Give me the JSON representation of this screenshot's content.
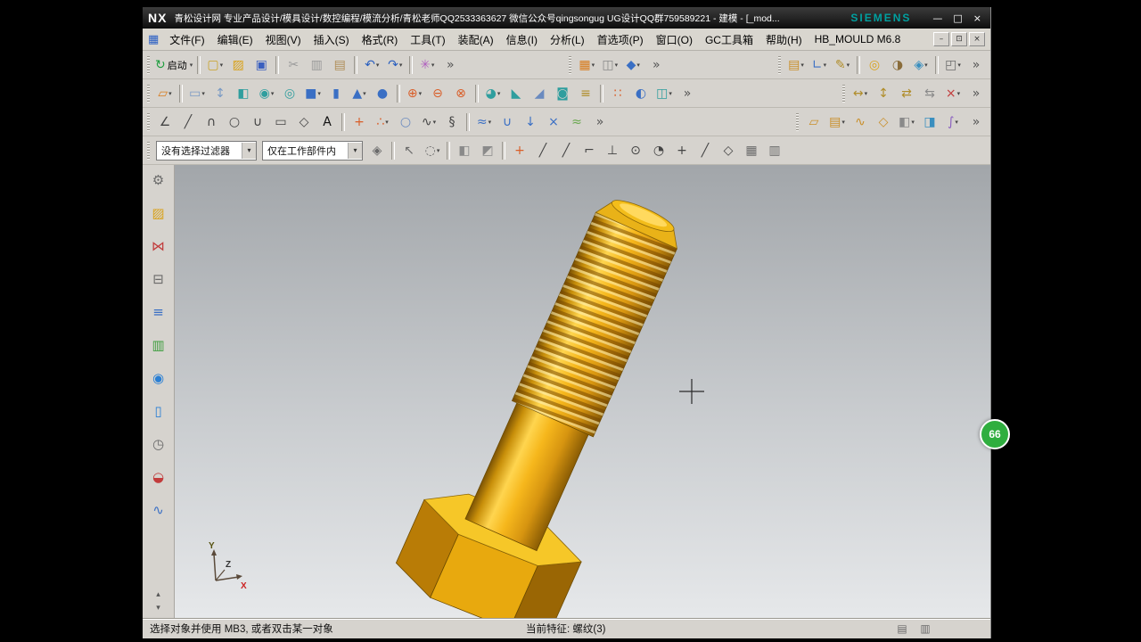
{
  "colors": {
    "brand": "#009999",
    "model_gold": "#f2b41a",
    "badge_green": "#2fae3f",
    "viewport_top": "#a2a6aa",
    "viewport_bottom": "#e6e8ea"
  },
  "window": {
    "logo": "NX",
    "title": "青松设计网 专业产品设计/模具设计/数控编程/模流分析/青松老师QQ2533363627 微信公众号qingsongug UG设计QQ群759589221 - 建模 - [_mod...",
    "brand": "SIEMENS",
    "controls": [
      {
        "n": "minimize-button",
        "g": "—",
        "c": "#ffffff"
      },
      {
        "n": "maximize-button",
        "g": "□",
        "c": "#ffffff"
      },
      {
        "n": "close-button",
        "g": "×",
        "c": "#ffffff"
      }
    ]
  },
  "menubar": {
    "child_icon_glyph": "▦",
    "items": [
      "文件(F)",
      "编辑(E)",
      "视图(V)",
      "插入(S)",
      "格式(R)",
      "工具(T)",
      "装配(A)",
      "信息(I)",
      "分析(L)",
      "首选项(P)",
      "窗口(O)",
      "GC工具箱",
      "帮助(H)",
      "HB_MOULD M6.8"
    ],
    "controls": [
      {
        "n": "child-minimize-button",
        "g": "–",
        "c": "#333333"
      },
      {
        "n": "child-restore-button",
        "g": "⊡",
        "c": "#333333"
      },
      {
        "n": "child-close-button",
        "g": "×",
        "c": "#333333"
      }
    ]
  },
  "toolbars": {
    "standard": [
      {
        "n": "start-button",
        "g": "↻",
        "c": "#1f9e3f",
        "label": "启动",
        "dd": true
      },
      {
        "n": "separator"
      },
      {
        "n": "new-file-button",
        "g": "▢",
        "c": "#c9a227",
        "dd": true
      },
      {
        "n": "open-file-button",
        "g": "▨",
        "c": "#d9a21b"
      },
      {
        "n": "save-button",
        "g": "▣",
        "c": "#3a5fbf"
      },
      {
        "n": "separator"
      },
      {
        "n": "cut-button",
        "g": "✂",
        "c": "#9a9a9a"
      },
      {
        "n": "copy-button",
        "g": "▥",
        "c": "#9a9a9a"
      },
      {
        "n": "paste-button",
        "g": "▤",
        "c": "#b08d57"
      },
      {
        "n": "separator"
      },
      {
        "n": "undo-button",
        "g": "↶",
        "c": "#2a5fbf",
        "dd": true
      },
      {
        "n": "redo-button",
        "g": "↷",
        "c": "#2a5fbf",
        "dd": true
      },
      {
        "n": "separator"
      },
      {
        "n": "command-finder-button",
        "g": "✳",
        "c": "#b05fbf",
        "dd": true
      },
      {
        "n": "overflow-chevron",
        "g": "»",
        "c": "#555555"
      }
    ],
    "view_group": [
      {
        "n": "display-mode-button",
        "g": "▦",
        "c": "#d97b1b",
        "dd": true
      },
      {
        "n": "show-hide-button",
        "g": "◫",
        "c": "#8a8a8a",
        "dd": true
      },
      {
        "n": "render-style-button",
        "g": "◆",
        "c": "#3a6fc4",
        "dd": true
      },
      {
        "n": "overflow-chevron",
        "g": "»",
        "c": "#555555"
      }
    ],
    "utility_group": [
      {
        "n": "layer-settings-button",
        "g": "▤",
        "c": "#c98f2a",
        "dd": true
      },
      {
        "n": "view-orientation-button",
        "g": "∟",
        "c": "#3a6fc4",
        "dd": true
      },
      {
        "n": "wcs-dynamics-button",
        "g": "✎",
        "c": "#b08d2a",
        "dd": true
      },
      {
        "n": "separator"
      },
      {
        "n": "measure-distance-button",
        "g": "◎",
        "c": "#d9a21b"
      },
      {
        "n": "assign-material-button",
        "g": "◑",
        "c": "#8a6d3b"
      },
      {
        "n": "spotlight-button",
        "g": "◈",
        "c": "#3a8fbf",
        "dd": true
      },
      {
        "n": "separator"
      },
      {
        "n": "window-layout-button",
        "g": "◰",
        "c": "#6a6a6a",
        "dd": true
      },
      {
        "n": "overflow-chevron",
        "g": "»",
        "c": "#555555"
      }
    ],
    "feature": [
      {
        "n": "sketch-button",
        "g": "▱",
        "c": "#d97b1b",
        "dd": true
      },
      {
        "n": "separator"
      },
      {
        "n": "datum-plane-button",
        "g": "▭",
        "c": "#7a9ac4",
        "dd": true
      },
      {
        "n": "datum-axis-button",
        "g": "↕",
        "c": "#7a9ac4"
      },
      {
        "n": "extrude-button",
        "g": "◧",
        "c": "#2f9e9e"
      },
      {
        "n": "revolve-button",
        "g": "◉",
        "c": "#2f9e9e",
        "dd": true
      },
      {
        "n": "hole-button",
        "g": "◎",
        "c": "#2f9e9e"
      },
      {
        "n": "block-button",
        "g": "■",
        "c": "#3a6fc4",
        "dd": true
      },
      {
        "n": "cylinder-button",
        "g": "▮",
        "c": "#3a6fc4"
      },
      {
        "n": "cone-button",
        "g": "▲",
        "c": "#3a6fc4",
        "dd": true
      },
      {
        "n": "sphere-button",
        "g": "●",
        "c": "#3a6fc4"
      },
      {
        "n": "separator"
      },
      {
        "n": "unite-button",
        "g": "⊕",
        "c": "#d95f2a",
        "dd": true
      },
      {
        "n": "subtract-button",
        "g": "⊖",
        "c": "#d95f2a"
      },
      {
        "n": "intersect-button",
        "g": "⊗",
        "c": "#d95f2a"
      },
      {
        "n": "separator"
      },
      {
        "n": "edge-blend-button",
        "g": "◕",
        "c": "#2f9e9e",
        "dd": true
      },
      {
        "n": "chamfer-button",
        "g": "◣",
        "c": "#2f9e9e"
      },
      {
        "n": "draft-button",
        "g": "◢",
        "c": "#6a8abf"
      },
      {
        "n": "shell-button",
        "g": "◙",
        "c": "#2f9e9e"
      },
      {
        "n": "thread-button",
        "g": "≡",
        "c": "#b08d2a"
      },
      {
        "n": "separator"
      },
      {
        "n": "pattern-feature-button",
        "g": "∷",
        "c": "#d95f2a"
      },
      {
        "n": "mirror-feature-button",
        "g": "◐",
        "c": "#3a6fc4"
      },
      {
        "n": "trim-body-button",
        "g": "◫",
        "c": "#2f9e9e",
        "dd": true
      },
      {
        "n": "overflow-chevron",
        "g": "»",
        "c": "#555555"
      }
    ],
    "synchronous": [
      {
        "n": "move-face-button",
        "g": "↔",
        "c": "#b08d2a",
        "dd": true
      },
      {
        "n": "pull-face-button",
        "g": "↕",
        "c": "#b08d2a"
      },
      {
        "n": "offset-region-button",
        "g": "⇄",
        "c": "#b08d2a"
      },
      {
        "n": "replace-face-button",
        "g": "⇆",
        "c": "#8a8a8a"
      },
      {
        "n": "delete-face-button",
        "g": "×",
        "c": "#c23b3b",
        "dd": true
      },
      {
        "n": "overflow-chevron",
        "g": "»",
        "c": "#555555"
      }
    ],
    "curve": [
      {
        "n": "profile-button",
        "g": "∠",
        "c": "#444444"
      },
      {
        "n": "line-button",
        "g": "╱",
        "c": "#444444"
      },
      {
        "n": "arc-button",
        "g": "∩",
        "c": "#444444"
      },
      {
        "n": "circle-button",
        "g": "○",
        "c": "#444444"
      },
      {
        "n": "fillet-button",
        "g": "∪",
        "c": "#444444"
      },
      {
        "n": "rectangle-button",
        "g": "▭",
        "c": "#444444"
      },
      {
        "n": "polygon-button",
        "g": "◇",
        "c": "#444444"
      },
      {
        "n": "text-button",
        "g": "A",
        "c": "#111111"
      },
      {
        "n": "separator"
      },
      {
        "n": "point-button",
        "g": "+",
        "c": "#d95f2a"
      },
      {
        "n": "point-set-button",
        "g": "∴",
        "c": "#d95f2a",
        "dd": true
      },
      {
        "n": "ellipse-button",
        "g": "○",
        "c": "#6a8abf"
      },
      {
        "n": "studio-spline-button",
        "g": "∿",
        "c": "#444444",
        "dd": true
      },
      {
        "n": "helix-button",
        "g": "§",
        "c": "#444444"
      },
      {
        "n": "separator"
      },
      {
        "n": "offset-curve-button",
        "g": "≈",
        "c": "#3a6fc4",
        "dd": true
      },
      {
        "n": "bridge-curve-button",
        "g": "∪",
        "c": "#3a6fc4"
      },
      {
        "n": "project-curve-button",
        "g": "↓",
        "c": "#3a6fc4"
      },
      {
        "n": "intersection-curve-button",
        "g": "×",
        "c": "#3a6fc4"
      },
      {
        "n": "section-curve-button",
        "g": "≈",
        "c": "#6aa84f"
      },
      {
        "n": "overflow-chevron",
        "g": "»",
        "c": "#555555"
      }
    ],
    "surface": [
      {
        "n": "ruled-surface-button",
        "g": "▱",
        "c": "#c98f2a"
      },
      {
        "n": "through-curves-button",
        "g": "▤",
        "c": "#c98f2a",
        "dd": true
      },
      {
        "n": "swept-button",
        "g": "∿",
        "c": "#c98f2a"
      },
      {
        "n": "n-sided-surface-button",
        "g": "◇",
        "c": "#c98f2a"
      },
      {
        "n": "offset-surface-button",
        "g": "◧",
        "c": "#8a8a8a",
        "dd": true
      },
      {
        "n": "trimmed-sheet-button",
        "g": "◨",
        "c": "#3a8fbf"
      },
      {
        "n": "sew-button",
        "g": "∫",
        "c": "#8a5fc0",
        "dd": true
      },
      {
        "n": "overflow-chevron",
        "g": "»",
        "c": "#555555"
      }
    ]
  },
  "selection_bar": {
    "filter_label": "没有选择过滤器",
    "scope_label": "仅在工作部件内",
    "icons": [
      {
        "n": "general-selection-filter-button",
        "g": "◈",
        "c": "#6a6a6a"
      },
      {
        "n": "separator"
      },
      {
        "n": "select-cursor-button",
        "g": "↖",
        "c": "#6a6a6a"
      },
      {
        "n": "lasso-button",
        "g": "◌",
        "c": "#6a6a6a",
        "dd": true
      },
      {
        "n": "separator"
      },
      {
        "n": "shaded-solid-button",
        "g": "◧",
        "c": "#8a8a8a"
      },
      {
        "n": "facet-body-button",
        "g": "◩",
        "c": "#8a8a8a"
      },
      {
        "n": "separator"
      },
      {
        "n": "snap-point-toggle",
        "g": "+",
        "c": "#d95f2a"
      },
      {
        "n": "end-point-snap-button",
        "g": "╱",
        "c": "#444444"
      },
      {
        "n": "mid-point-snap-button",
        "g": "╱",
        "c": "#444444"
      },
      {
        "n": "control-point-snap-button",
        "g": "⌐",
        "c": "#444444"
      },
      {
        "n": "intersection-snap-button",
        "g": "⊥",
        "c": "#444444"
      },
      {
        "n": "arc-center-snap-button",
        "g": "⊙",
        "c": "#444444"
      },
      {
        "n": "quadrant-snap-button",
        "g": "◔",
        "c": "#444444"
      },
      {
        "n": "existing-point-snap-button",
        "g": "+",
        "c": "#444444"
      },
      {
        "n": "point-on-curve-snap-button",
        "g": "╱",
        "c": "#444444"
      },
      {
        "n": "point-on-face-snap-button",
        "g": "◇",
        "c": "#444444"
      },
      {
        "n": "grid-snap-button",
        "g": "▦",
        "c": "#6a6a6a"
      },
      {
        "n": "snap-options-button",
        "g": "▥",
        "c": "#6a6a6a"
      }
    ]
  },
  "resource_bar": {
    "items": [
      {
        "n": "navigation-gear-icon",
        "g": "⚙",
        "c": "#6a6a6a"
      },
      {
        "n": "roles-icon",
        "g": "▨",
        "c": "#d9a21b"
      },
      {
        "n": "assembly-navigator-icon",
        "g": "⋈",
        "c": "#c23b3b"
      },
      {
        "n": "constraint-navigator-icon",
        "g": "⊟",
        "c": "#6a6a6a"
      },
      {
        "n": "part-navigator-icon",
        "g": "≡",
        "c": "#3a6fc4"
      },
      {
        "n": "reuse-library-icon",
        "g": "▥",
        "c": "#3f9e3f"
      },
      {
        "n": "internet-explorer-icon",
        "g": "◉",
        "c": "#2a7fd4"
      },
      {
        "n": "help-library-icon",
        "g": "▯",
        "c": "#2a7fd4"
      },
      {
        "n": "history-icon",
        "g": "◷",
        "c": "#6a6a6a"
      },
      {
        "n": "materials-icon",
        "g": "◒",
        "c": "#c23b3b"
      },
      {
        "n": "process-studio-icon",
        "g": "∿",
        "c": "#3a6fc4"
      }
    ],
    "scroll": [
      {
        "n": "resource-scroll-up-button",
        "g": "▴",
        "c": "#555555"
      },
      {
        "n": "resource-scroll-down-button",
        "g": "▾",
        "c": "#555555"
      }
    ]
  },
  "viewport": {
    "triad": {
      "x": "X",
      "y": "Y",
      "z": "Z"
    },
    "badge": "66"
  },
  "statusbar": {
    "prompt": "选择对象并使用 MB3, 或者双击某一对象",
    "feature": "当前特征: 螺纹(3)",
    "icons": [
      {
        "n": "status-doc-icon",
        "g": "▤",
        "c": "#6a6a6a"
      },
      {
        "n": "status-clip-icon",
        "g": "▥",
        "c": "#6a6a6a"
      }
    ]
  }
}
